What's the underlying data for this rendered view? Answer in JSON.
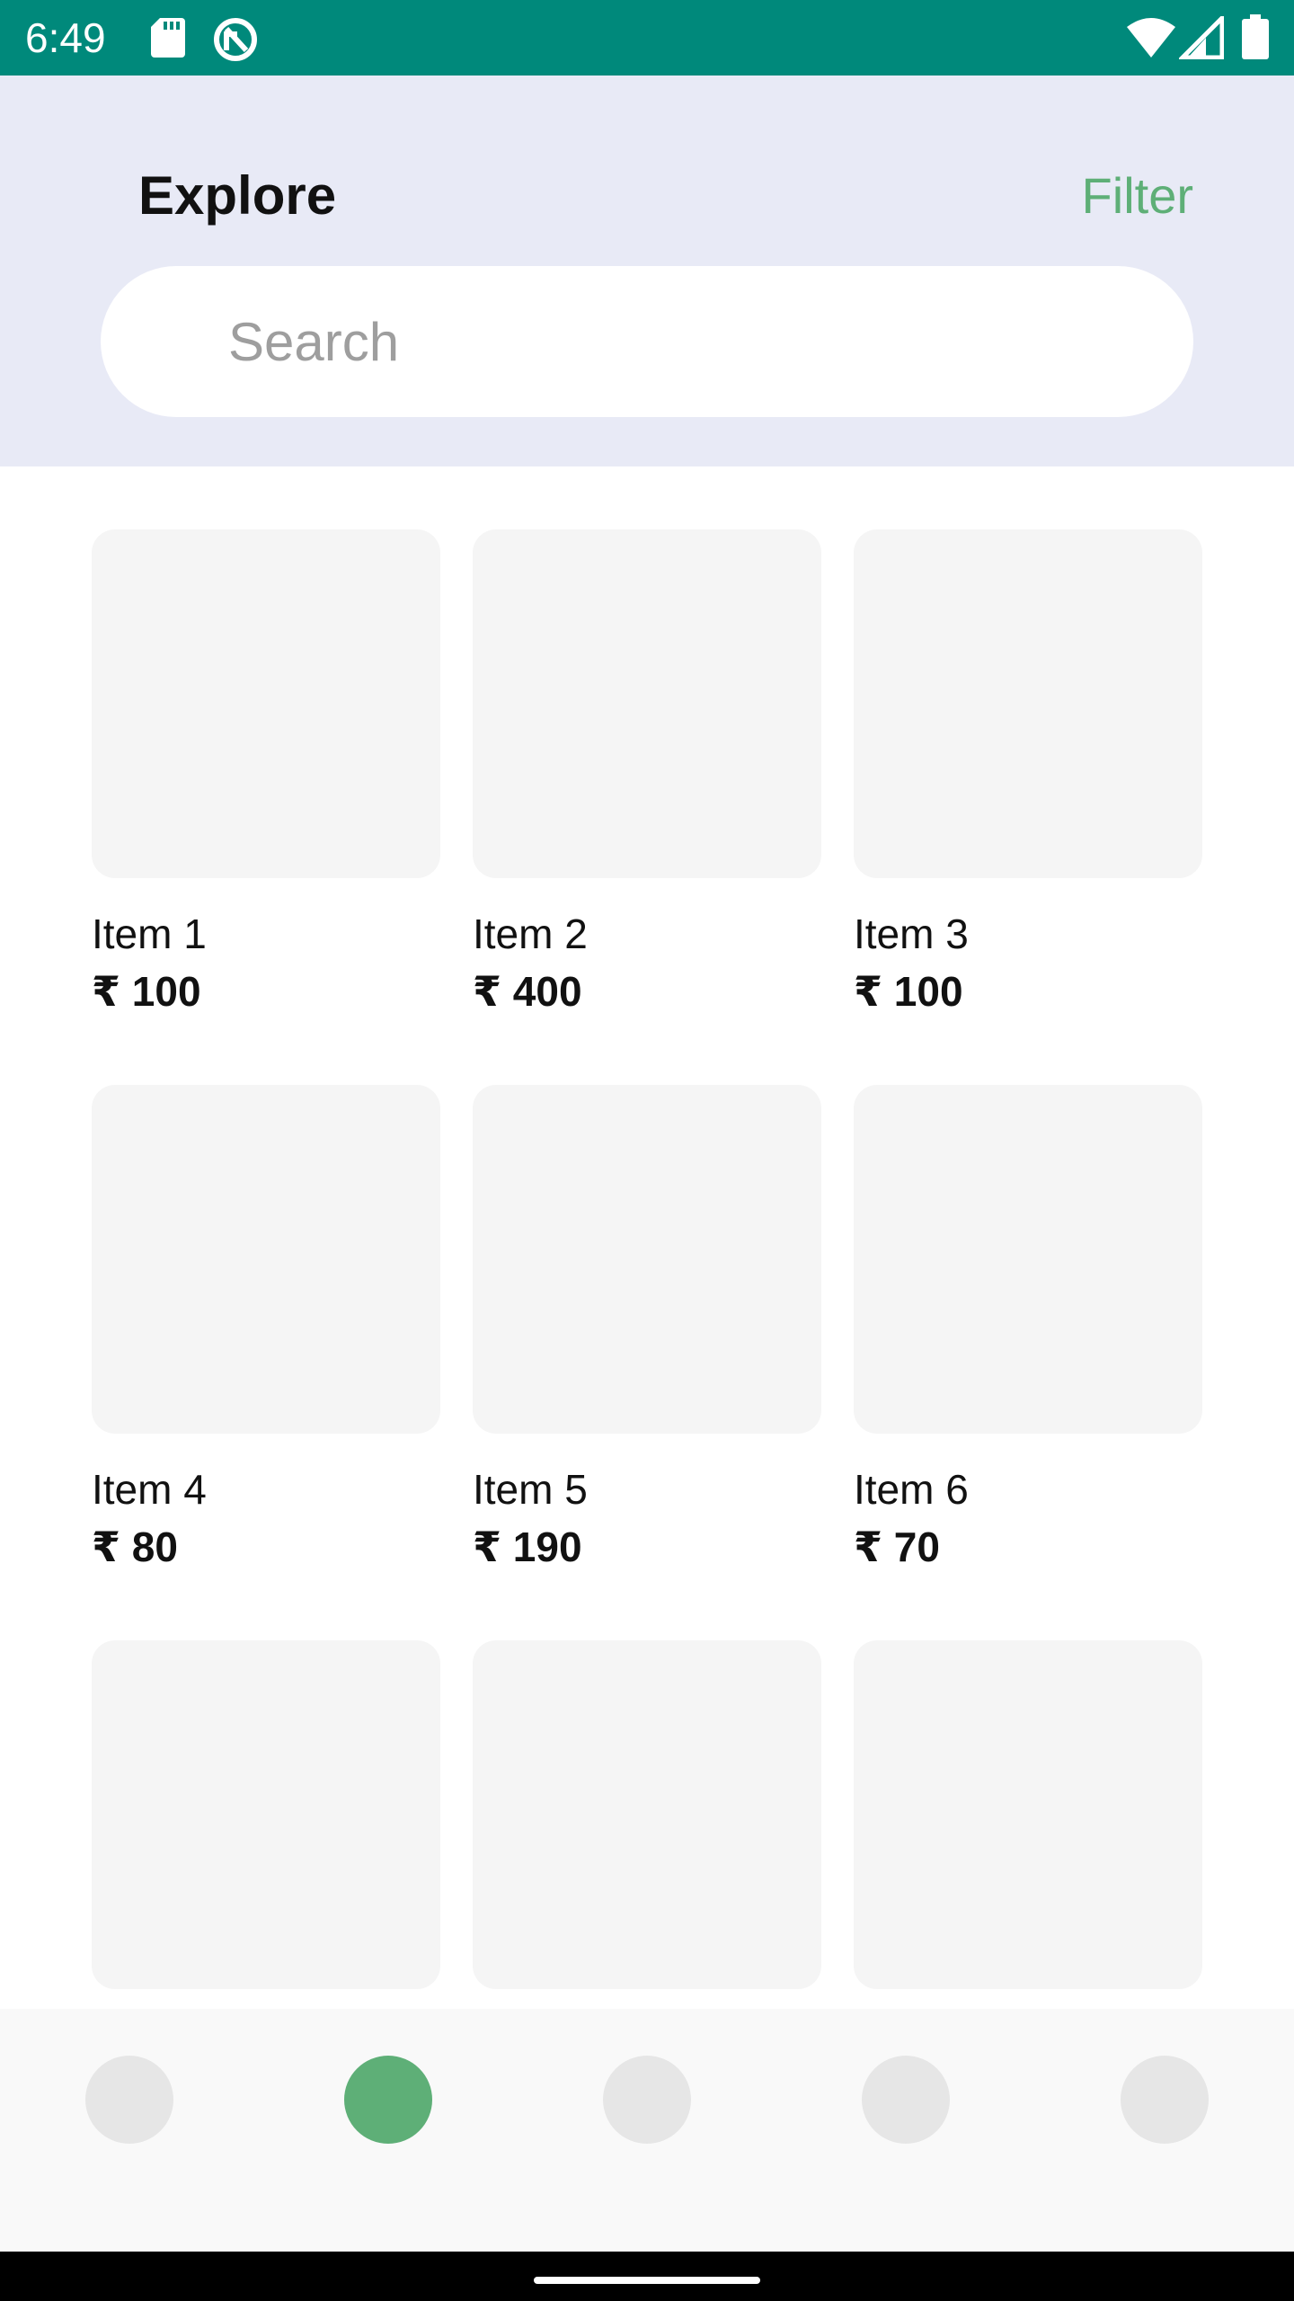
{
  "status_bar": {
    "time": "6:49",
    "icons": [
      "sd-card-icon",
      "sync-icon",
      "wifi-icon",
      "cell-signal-icon",
      "battery-icon"
    ],
    "background_color": "#00897b"
  },
  "header": {
    "title": "Explore",
    "filter_label": "Filter",
    "background_color": "#e8eaf6",
    "accent_color": "#5eaf77"
  },
  "search": {
    "placeholder": "Search",
    "value": ""
  },
  "items": [
    {
      "name": "Item 1",
      "price": "₹ 100"
    },
    {
      "name": "Item 2",
      "price": "₹ 400"
    },
    {
      "name": "Item 3",
      "price": "₹ 100"
    },
    {
      "name": "Item 4",
      "price": "₹ 80"
    },
    {
      "name": "Item 5",
      "price": "₹ 190"
    },
    {
      "name": "Item 6",
      "price": "₹ 70"
    },
    {
      "name": "",
      "price": ""
    },
    {
      "name": "",
      "price": ""
    },
    {
      "name": "",
      "price": ""
    }
  ],
  "bottom_nav": {
    "tabs": [
      {
        "name": "nav-tab-1",
        "active": false
      },
      {
        "name": "nav-tab-2",
        "active": true
      },
      {
        "name": "nav-tab-3",
        "active": false
      },
      {
        "name": "nav-tab-4",
        "active": false
      },
      {
        "name": "nav-tab-5",
        "active": false
      }
    ],
    "active_color": "#5eaf77",
    "inactive_color": "#e6e6e6"
  }
}
